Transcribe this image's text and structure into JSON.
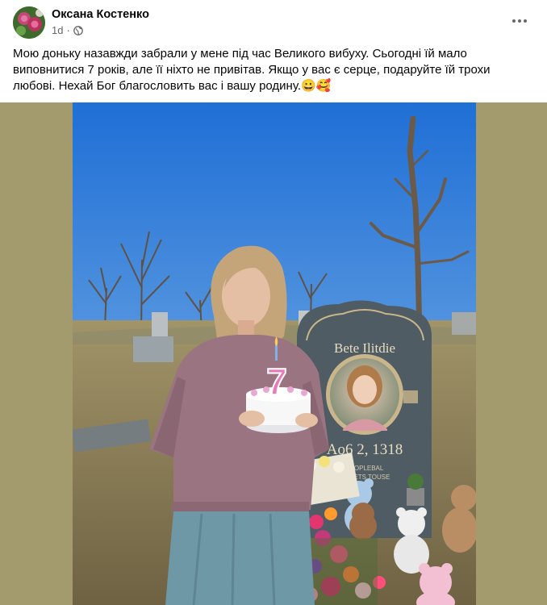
{
  "post": {
    "author": "Оксана Костенко",
    "time": "1d",
    "separator": "·",
    "text": "Мою доньку назавжди забрали у мене під час Великого вибуху. Сьогодні їй мало виповнитися 7 років, але її ніхто не привітав. Якщо у вас є серце, подаруйте їй трохи любові. Нехай Бог благословить вас і вашу родину.😀🥰",
    "privacy_icon": "globe-icon",
    "menu_icon": "more-options-icon"
  },
  "photo": {
    "candle_number": "7",
    "headstone_name": "Bete Ilitdie",
    "headstone_date": "Ao6 2, 1318",
    "headstone_line1": "CIIOPLEBAL",
    "headstone_line2": "OSJIETS TOUSE"
  },
  "colors": {
    "sky_top": "#1f6fd6",
    "sky_bottom": "#a9cde8",
    "ground": "#8a7a55",
    "sweater": "#9a7480",
    "skirt": "#6f98a6",
    "headstone": "#4f5c63",
    "side_bg": "#a39a6e"
  }
}
